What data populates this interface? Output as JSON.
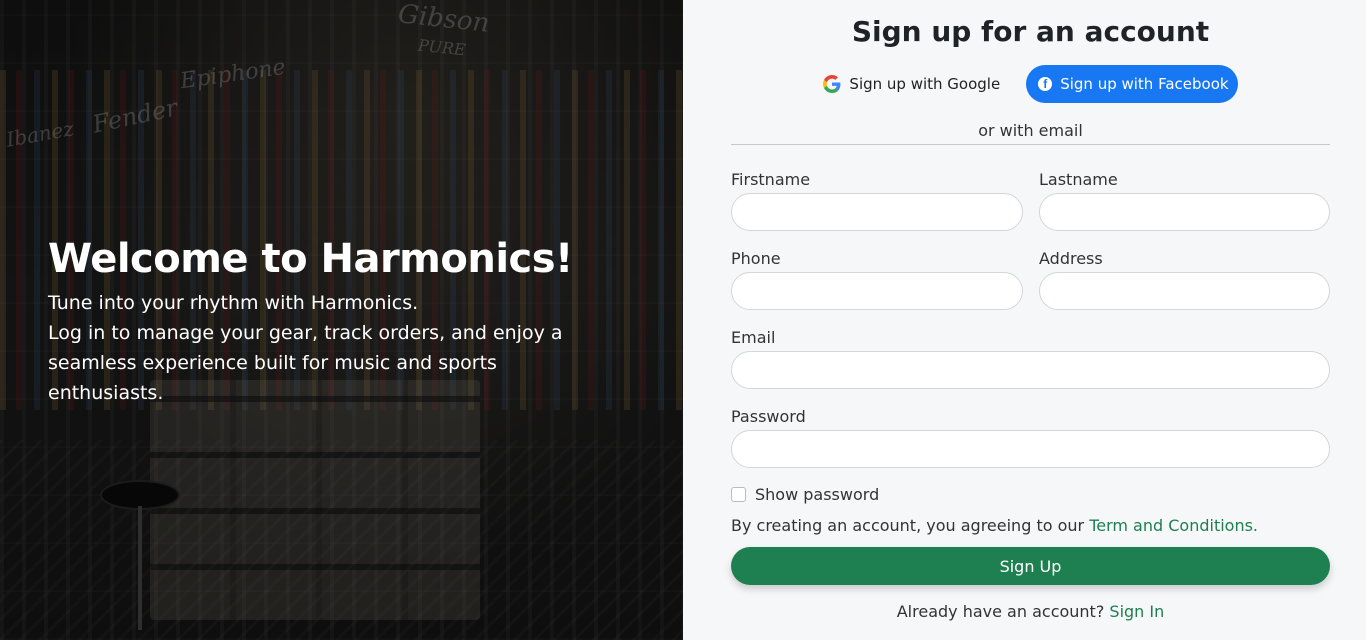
{
  "hero": {
    "title": "Welcome to Harmonics!",
    "line1": "Tune into your rhythm with Harmonics.",
    "line2": "Log in to manage your gear, track orders, and enjoy a seamless experience built for music and sports enthusiasts.",
    "bg_brands": [
      "Epiphone",
      "Fender",
      "Ibanez",
      "Gibson",
      "PURE"
    ]
  },
  "form": {
    "title": "Sign up for an account",
    "google_label": "Sign up with Google",
    "facebook_label": "Sign up with Facebook",
    "divider": "or with email",
    "firstname_label": "Firstname",
    "lastname_label": "Lastname",
    "phone_label": "Phone",
    "address_label": "Address",
    "email_label": "Email",
    "password_label": "Password",
    "show_password_label": "Show password",
    "terms_prefix": "By creating an account, you agreeing to our",
    "terms_link": "Term and Conditions.",
    "submit_label": "Sign Up",
    "signin_prefix": "Already have an account?",
    "signin_link": "Sign In"
  },
  "colors": {
    "accent": "#1e8050",
    "facebook": "#1877f2",
    "panel_bg": "#f6f7f9"
  }
}
